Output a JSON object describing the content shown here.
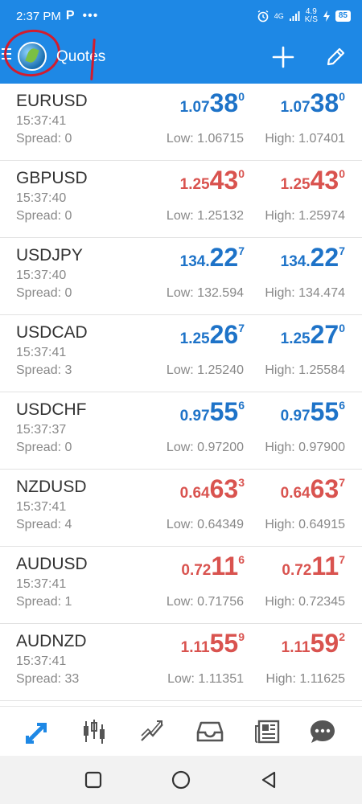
{
  "status_bar": {
    "time": "2:37 PM",
    "indicator": "P",
    "more": "•••",
    "network_top": "4.9",
    "network_bottom": "K/S",
    "signal": "4G",
    "battery": "85"
  },
  "app_bar": {
    "title": "Quotes"
  },
  "colors": {
    "accent": "#1E88E5",
    "up": "#1E73C8",
    "down": "#D9534F"
  },
  "quotes": [
    {
      "symbol": "EURUSD",
      "time": "15:37:41",
      "spread": "Spread: 0",
      "color": "#1E73C8",
      "bid": {
        "small": "1.07",
        "big": "38",
        "sup": "0"
      },
      "ask": {
        "small": "1.07",
        "big": "38",
        "sup": "0"
      },
      "low": "Low: 1.06715",
      "high": "High: 1.07401"
    },
    {
      "symbol": "GBPUSD",
      "time": "15:37:40",
      "spread": "Spread: 0",
      "color": "#D9534F",
      "bid": {
        "small": "1.25",
        "big": "43",
        "sup": "0"
      },
      "ask": {
        "small": "1.25",
        "big": "43",
        "sup": "0"
      },
      "low": "Low: 1.25132",
      "high": "High: 1.25974"
    },
    {
      "symbol": "USDJPY",
      "time": "15:37:40",
      "spread": "Spread: 0",
      "color": "#1E73C8",
      "bid": {
        "small": "134.",
        "big": "22",
        "sup": "7"
      },
      "ask": {
        "small": "134.",
        "big": "22",
        "sup": "7"
      },
      "low": "Low: 132.594",
      "high": "High: 134.474"
    },
    {
      "symbol": "USDCAD",
      "time": "15:37:41",
      "spread": "Spread: 3",
      "color": "#1E73C8",
      "bid": {
        "small": "1.25",
        "big": "26",
        "sup": "7"
      },
      "ask": {
        "small": "1.25",
        "big": "27",
        "sup": "0"
      },
      "low": "Low: 1.25240",
      "high": "High: 1.25584"
    },
    {
      "symbol": "USDCHF",
      "time": "15:37:37",
      "spread": "Spread: 0",
      "color": "#1E73C8",
      "bid": {
        "small": "0.97",
        "big": "55",
        "sup": "6"
      },
      "ask": {
        "small": "0.97",
        "big": "55",
        "sup": "6"
      },
      "low": "Low: 0.97200",
      "high": "High: 0.97900"
    },
    {
      "symbol": "NZDUSD",
      "time": "15:37:41",
      "spread": "Spread: 4",
      "color": "#D9534F",
      "bid": {
        "small": "0.64",
        "big": "63",
        "sup": "3"
      },
      "ask": {
        "small": "0.64",
        "big": "63",
        "sup": "7"
      },
      "low": "Low: 0.64349",
      "high": "High: 0.64915"
    },
    {
      "symbol": "AUDUSD",
      "time": "15:37:41",
      "spread": "Spread: 1",
      "color": "#D9534F",
      "bid": {
        "small": "0.72",
        "big": "11",
        "sup": "6"
      },
      "ask": {
        "small": "0.72",
        "big": "11",
        "sup": "7"
      },
      "low": "Low: 0.71756",
      "high": "High: 0.72345"
    },
    {
      "symbol": "AUDNZD",
      "time": "15:37:41",
      "spread": "Spread: 33",
      "color": "#D9534F",
      "bid": {
        "small": "1.11",
        "big": "55",
        "sup": "9"
      },
      "ask": {
        "small": "1.11",
        "big": "59",
        "sup": "2"
      },
      "low": "Low: 1.11351",
      "high": "High: 1.11625"
    }
  ],
  "bottom_nav": [
    {
      "icon": "quotes-arrows-icon",
      "active": true
    },
    {
      "icon": "candlestick-chart-icon",
      "active": false
    },
    {
      "icon": "trade-chart-icon",
      "active": false
    },
    {
      "icon": "inbox-icon",
      "active": false
    },
    {
      "icon": "news-icon",
      "active": false
    },
    {
      "icon": "chat-icon",
      "active": false
    }
  ],
  "system_nav": [
    {
      "icon": "square-icon"
    },
    {
      "icon": "circle-icon"
    },
    {
      "icon": "triangle-back-icon"
    }
  ]
}
